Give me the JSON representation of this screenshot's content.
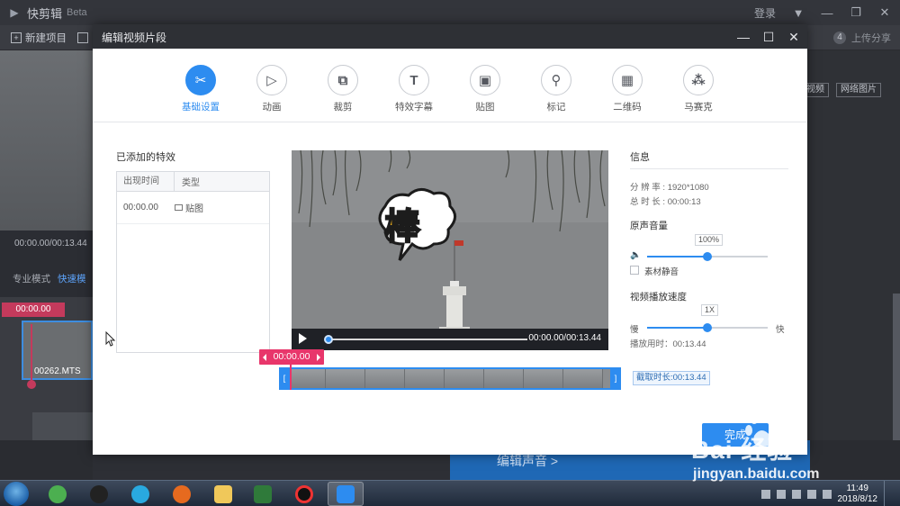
{
  "app": {
    "title": "快剪辑",
    "beta": "Beta",
    "login": "登录",
    "toolbar": {
      "new_project": "新建项目",
      "upload": "上传分享",
      "upload_num": "4"
    },
    "preview_time": "00:00.00/00:13.44",
    "modes": {
      "pro": "专业模式",
      "fast": "快速模"
    },
    "right_buttons": {
      "video": "视频",
      "web_image": "网络图片"
    },
    "clip": {
      "time": "00:00.00",
      "name": "00262.MTS"
    },
    "bottom": {
      "edit_audio": "编辑声音 >"
    }
  },
  "modal": {
    "title": "编辑视频片段",
    "tabs": [
      {
        "label": "基础设置",
        "glyph": "✂"
      },
      {
        "label": "动画",
        "glyph": "▷"
      },
      {
        "label": "裁剪",
        "glyph": "⧉"
      },
      {
        "label": "特效字幕",
        "glyph": "T"
      },
      {
        "label": "贴图",
        "glyph": "▣"
      },
      {
        "label": "标记",
        "glyph": "⚲"
      },
      {
        "label": "二维码",
        "glyph": "▦"
      },
      {
        "label": "马赛克",
        "glyph": "⁂"
      }
    ],
    "effects": {
      "title": "已添加的特效",
      "col_time": "出现时间",
      "col_type": "类型",
      "rows": [
        {
          "time": "00:00.00",
          "type": "贴图"
        }
      ]
    },
    "player": {
      "time": "00:00.00/00:13.44",
      "progress": 0.0
    },
    "timeline": {
      "time": "00:00.00",
      "cut_duration": "截取时长:00:13.44"
    },
    "info": {
      "title": "信息",
      "resolution_label": "分 辨 率 :",
      "resolution": "1920*1080",
      "duration_label": "总 时 长 :",
      "duration": "00:00:13",
      "volume_title": "原声音量",
      "volume_value": "100%",
      "volume_level": 0.5,
      "mute_label": "素材静音",
      "speed_title": "视频播放速度",
      "speed_value": "1X",
      "speed_slow": "慢",
      "speed_fast": "快",
      "play_time": "播放用时：00:13.44"
    },
    "done": "完成",
    "sticker_char": "棒"
  },
  "taskbar": {
    "time": "11:49",
    "date": "2018/8/12"
  },
  "watermark": {
    "brand": "Bai 经验",
    "url": "jingyan.baidu.com"
  },
  "colors": {
    "accent": "#2d8cf0",
    "marker": "#e8366b"
  }
}
